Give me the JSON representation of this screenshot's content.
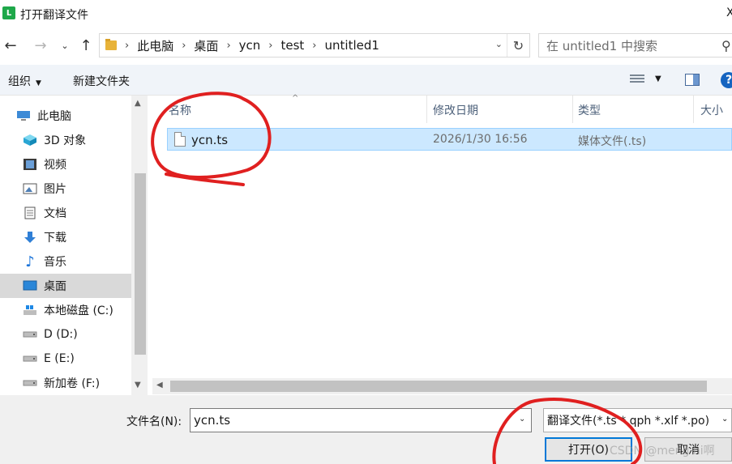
{
  "window": {
    "app_icon_letter": "L",
    "title": "打开翻译文件",
    "close_glyph": "X"
  },
  "nav": {
    "back_icon": "arrow-left-icon",
    "forward_icon": "arrow-right-icon",
    "recent_icon": "chevron-down-icon",
    "up_icon": "arrow-up-icon"
  },
  "address": {
    "crumbs": [
      "此电脑",
      "桌面",
      "ycn",
      "test",
      "untitled1"
    ]
  },
  "search": {
    "placeholder": "在 untitled1 中搜索"
  },
  "toolbar": {
    "organize_label": "组织",
    "new_folder_label": "新建文件夹",
    "help_label": "?"
  },
  "sidebar": {
    "items": [
      {
        "label": "此电脑",
        "icon": "computer-icon"
      },
      {
        "label": "3D 对象",
        "icon": "cube-icon"
      },
      {
        "label": "视频",
        "icon": "video-icon"
      },
      {
        "label": "图片",
        "icon": "picture-icon"
      },
      {
        "label": "文档",
        "icon": "document-icon"
      },
      {
        "label": "下载",
        "icon": "download-icon"
      },
      {
        "label": "音乐",
        "icon": "music-icon"
      },
      {
        "label": "桌面",
        "icon": "desktop-icon",
        "selected": true
      },
      {
        "label": "本地磁盘 (C:)",
        "icon": "windows-drive-icon"
      },
      {
        "label": "D (D:)",
        "icon": "drive-icon"
      },
      {
        "label": "E (E:)",
        "icon": "drive-icon"
      },
      {
        "label": "新加卷 (F:)",
        "icon": "drive-icon"
      }
    ]
  },
  "filelist": {
    "columns": [
      "名称",
      "修改日期",
      "类型",
      "大小"
    ],
    "rows": [
      {
        "name": "ycn.ts",
        "modified": "2026/1/30 16:56",
        "type": "媒体文件(.ts)",
        "size": ""
      }
    ]
  },
  "footer": {
    "filename_label": "文件名(N):",
    "filename_value": "ycn.ts",
    "filetype_value": "翻译文件(*.ts *.qph *.xlf *.po)",
    "open_label": "打开(O)",
    "cancel_label": "取消",
    "watermark": "CSDN @meng hi啊"
  },
  "annotation": {
    "color": "#e02020"
  }
}
